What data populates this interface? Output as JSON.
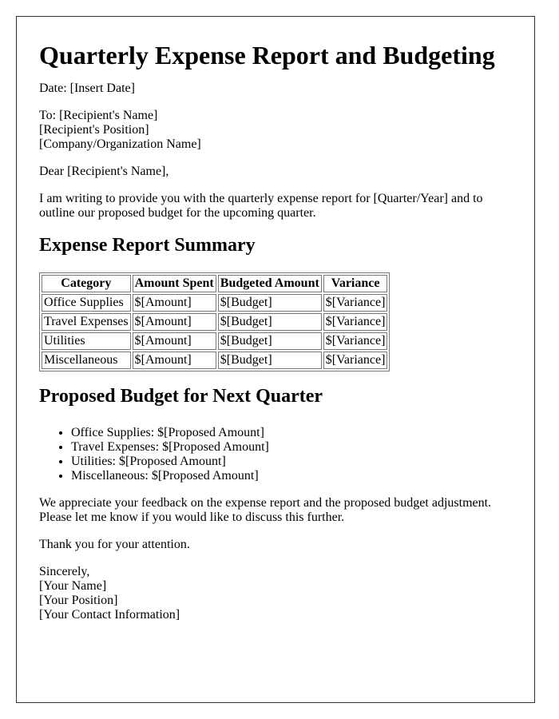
{
  "title": "Quarterly Expense Report and Budgeting",
  "date_line": "Date: [Insert Date]",
  "recipient": {
    "to_line": "To: [Recipient's Name]",
    "position": "[Recipient's Position]",
    "company": "[Company/Organization Name]"
  },
  "salutation": "Dear [Recipient's Name],",
  "intro": "I am writing to provide you with the quarterly expense report for [Quarter/Year] and to outline our proposed budget for the upcoming quarter.",
  "summary": {
    "heading": "Expense Report Summary",
    "columns": [
      "Category",
      "Amount Spent",
      "Budgeted Amount",
      "Variance"
    ],
    "rows": [
      [
        "Office Supplies",
        "$[Amount]",
        "$[Budget]",
        "$[Variance]"
      ],
      [
        "Travel Expenses",
        "$[Amount]",
        "$[Budget]",
        "$[Variance]"
      ],
      [
        "Utilities",
        "$[Amount]",
        "$[Budget]",
        "$[Variance]"
      ],
      [
        "Miscellaneous",
        "$[Amount]",
        "$[Budget]",
        "$[Variance]"
      ]
    ]
  },
  "proposed": {
    "heading": "Proposed Budget for Next Quarter",
    "items": [
      "Office Supplies: $[Proposed Amount]",
      "Travel Expenses: $[Proposed Amount]",
      "Utilities: $[Proposed Amount]",
      "Miscellaneous: $[Proposed Amount]"
    ]
  },
  "feedback": "We appreciate your feedback on the expense report and the proposed budget adjustment. Please let me know if you would like to discuss this further.",
  "thanks": "Thank you for your attention.",
  "closing": {
    "sign_off": "Sincerely,",
    "name": "[Your Name]",
    "position": "[Your Position]",
    "contact": "[Your Contact Information]"
  }
}
